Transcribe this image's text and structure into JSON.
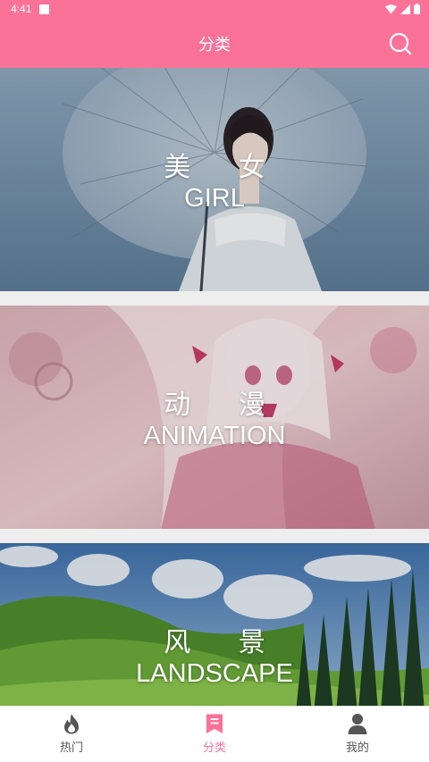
{
  "status_bar": {
    "time": "4:41"
  },
  "header": {
    "title": "分类"
  },
  "categories": [
    {
      "cn": "美 女",
      "en": "GIRL"
    },
    {
      "cn": "动 漫",
      "en": "ANIMATION"
    },
    {
      "cn": "风 景",
      "en": "LANDSCAPE"
    }
  ],
  "bottom_nav": [
    {
      "label": "热门",
      "icon": "flame-icon"
    },
    {
      "label": "分类",
      "icon": "bookmark-icon"
    },
    {
      "label": "我的",
      "icon": "user-icon"
    }
  ],
  "colors": {
    "accent": "#fb7299",
    "inactive": "#555555"
  }
}
